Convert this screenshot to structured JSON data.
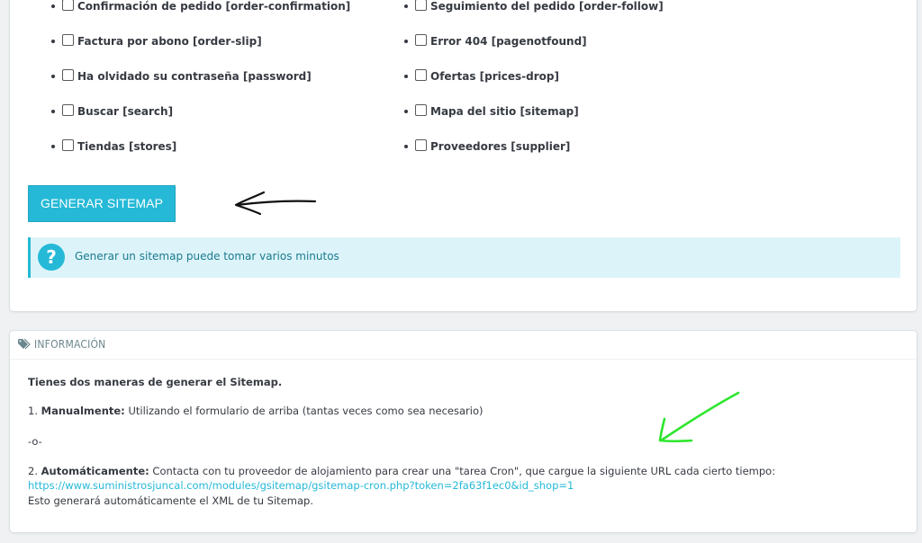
{
  "checkboxes": {
    "left": [
      "Confirmación de pedido [order-confirmation]",
      "Factura por abono [order-slip]",
      "Ha olvidado su contraseña [password]",
      "Buscar [search]",
      "Tiendas [stores]"
    ],
    "right": [
      "Seguimiento del pedido [order-follow]",
      "Error 404 [pagenotfound]",
      "Ofertas [prices-drop]",
      "Mapa del sitio [sitemap]",
      "Proveedores [supplier]"
    ]
  },
  "generate_button": "GENERAR SITEMAP",
  "alert": {
    "icon": "question-icon",
    "text": "Generar un sitemap puede tomar varios minutos"
  },
  "info": {
    "title": "INFORMACIÓN",
    "intro": "Tienes dos maneras de generar el Sitemap.",
    "manual_prefix": "1. ",
    "manual_label": "Manualmente:",
    "manual_text": " Utilizando el formulario de arriba (tantas veces como sea necesario)",
    "separator": "-o-",
    "auto_prefix": "2. ",
    "auto_label": "Automáticamente:",
    "auto_text": " Contacta con tu proveedor de alojamiento para crear una \"tarea Cron\", que cargue la siguiente URL cada cierto tiempo:",
    "cron_url": "https://www.suministrosjuncal.com/modules/gsitemap/gsitemap-cron.php?token=2fa63f1ec0&id_shop=1",
    "result_text": "Esto generará automáticamente el XML de tu Sitemap."
  },
  "colors": {
    "accent": "#25b9d7",
    "alert_bg": "#dcf4f9",
    "annotation_green": "#2ee62e",
    "annotation_black": "#111111"
  }
}
